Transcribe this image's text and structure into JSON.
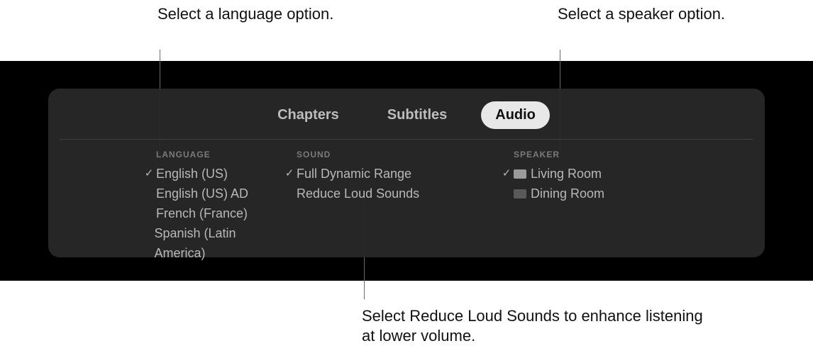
{
  "callouts": {
    "language": "Select a language option.",
    "speaker": "Select a speaker option.",
    "sound": "Select Reduce Loud Sounds to enhance listening at lower volume."
  },
  "tabs": {
    "chapters": "Chapters",
    "subtitles": "Subtitles",
    "audio": "Audio"
  },
  "headers": {
    "language": "LANGUAGE",
    "sound": "SOUND",
    "speaker": "SPEAKER"
  },
  "language": {
    "items": [
      {
        "label": "English (US)",
        "selected": true
      },
      {
        "label": "English (US) AD",
        "selected": false
      },
      {
        "label": "French (France)",
        "selected": false
      },
      {
        "label": "Spanish (Latin America)",
        "selected": false
      }
    ]
  },
  "sound": {
    "items": [
      {
        "label": "Full Dynamic Range",
        "selected": true
      },
      {
        "label": "Reduce Loud Sounds",
        "selected": false
      }
    ]
  },
  "speaker": {
    "items": [
      {
        "label": "Living Room",
        "selected": true
      },
      {
        "label": "Dining Room",
        "selected": false
      }
    ]
  },
  "checkmark": "✓"
}
